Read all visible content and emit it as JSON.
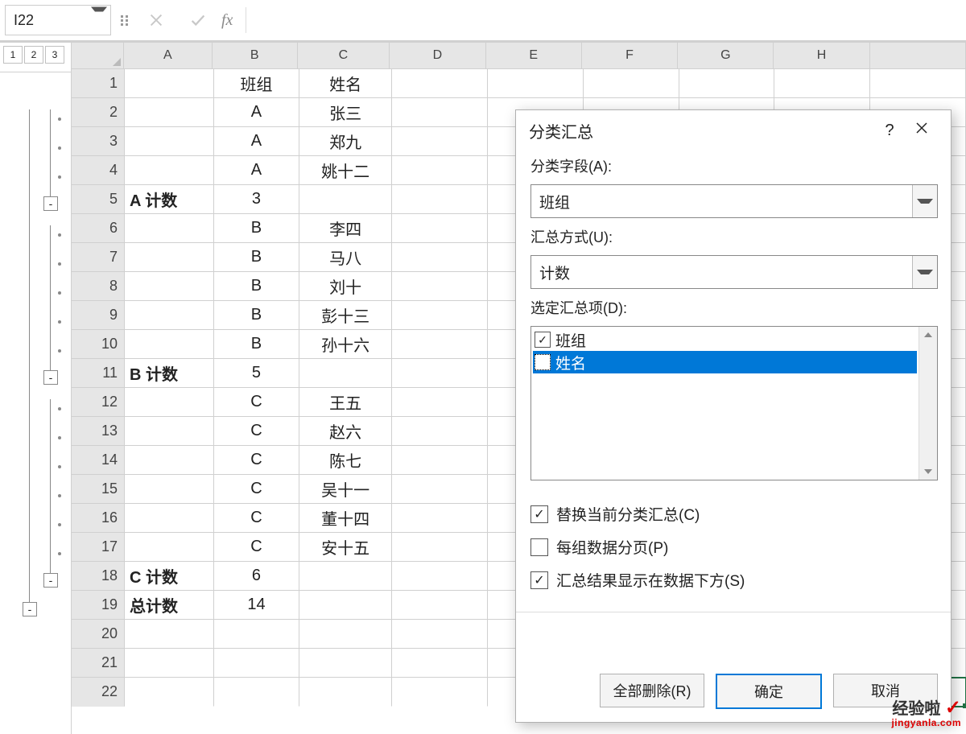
{
  "formula_bar": {
    "name_box": "I22",
    "fx_label": "fx",
    "formula_value": ""
  },
  "outline": {
    "levels": [
      "1",
      "2",
      "3"
    ],
    "collapse_symbol": "-"
  },
  "columns": [
    "A",
    "B",
    "C",
    "D",
    "E",
    "F",
    "G",
    "H"
  ],
  "row_numbers": [
    "1",
    "2",
    "3",
    "4",
    "5",
    "6",
    "7",
    "8",
    "9",
    "10",
    "11",
    "12",
    "13",
    "14",
    "15",
    "16",
    "17",
    "18",
    "19",
    "20",
    "21",
    "22"
  ],
  "cells": {
    "r1": {
      "A": "",
      "B": "班组",
      "C": "姓名"
    },
    "r2": {
      "A": "",
      "B": "A",
      "C": "张三"
    },
    "r3": {
      "A": "",
      "B": "A",
      "C": "郑九"
    },
    "r4": {
      "A": "",
      "B": "A",
      "C": "姚十二"
    },
    "r5": {
      "A": "A 计数",
      "B": "3",
      "C": ""
    },
    "r6": {
      "A": "",
      "B": "B",
      "C": "李四"
    },
    "r7": {
      "A": "",
      "B": "B",
      "C": "马八"
    },
    "r8": {
      "A": "",
      "B": "B",
      "C": "刘十"
    },
    "r9": {
      "A": "",
      "B": "B",
      "C": "彭十三"
    },
    "r10": {
      "A": "",
      "B": "B",
      "C": "孙十六"
    },
    "r11": {
      "A": "B 计数",
      "B": "5",
      "C": ""
    },
    "r12": {
      "A": "",
      "B": "C",
      "C": "王五"
    },
    "r13": {
      "A": "",
      "B": "C",
      "C": "赵六"
    },
    "r14": {
      "A": "",
      "B": "C",
      "C": "陈七"
    },
    "r15": {
      "A": "",
      "B": "C",
      "C": "吴十一"
    },
    "r16": {
      "A": "",
      "B": "C",
      "C": "董十四"
    },
    "r17": {
      "A": "",
      "B": "C",
      "C": "安十五"
    },
    "r18": {
      "A": "C 计数",
      "B": "6",
      "C": ""
    },
    "r19": {
      "A": "总计数",
      "B": "14",
      "C": ""
    },
    "r20": {
      "A": "",
      "B": "",
      "C": ""
    },
    "r21": {
      "A": "",
      "B": "",
      "C": ""
    },
    "r22": {
      "A": "",
      "B": "",
      "C": ""
    }
  },
  "bold_rows": [
    "r5",
    "r11",
    "r18",
    "r19"
  ],
  "selected_cell": "I22",
  "dialog": {
    "title": "分类汇总",
    "help_symbol": "?",
    "group_field_label": "分类字段(A):",
    "group_field_value": "班组",
    "summary_method_label": "汇总方式(U):",
    "summary_method_value": "计数",
    "selected_items_label": "选定汇总项(D):",
    "items": [
      {
        "label": "班组",
        "checked": true,
        "selected": false
      },
      {
        "label": "姓名",
        "checked": false,
        "selected": true
      }
    ],
    "replace_label": "替换当前分类汇总(C)",
    "replace_checked": true,
    "page_break_label": "每组数据分页(P)",
    "page_break_checked": false,
    "summary_below_label": "汇总结果显示在数据下方(S)",
    "summary_below_checked": true,
    "remove_all_btn": "全部删除(R)",
    "ok_btn": "确定",
    "cancel_btn": "取消"
  },
  "watermark": {
    "line1_text": "经验啦",
    "line2_text": "jingyanla.com"
  }
}
